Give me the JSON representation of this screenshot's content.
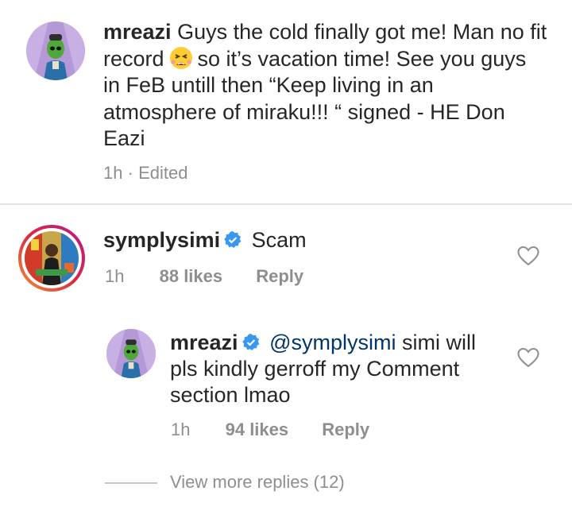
{
  "caption": {
    "username": "mreazi",
    "text_part1": "Guys the cold finally got me! Man no fit record",
    "emoji": "tired-face-emoji",
    "text_part2": "so it’s vacation time! See you guys in FeB untill then “Keep living in an atmosphere of miraku!!! “ signed - HE Don Eazi",
    "time": "1h",
    "separator": "·",
    "edited": "Edited"
  },
  "comment1": {
    "username": "symplysimi",
    "verified": true,
    "text": "Scam",
    "time": "1h",
    "likes": "88 likes",
    "reply": "Reply"
  },
  "reply1": {
    "username": "mreazi",
    "verified": true,
    "mention": "@symplysimi",
    "text": "simi will pls kindly gerroff my Comment section lmao",
    "time": "1h",
    "likes": "94 likes",
    "reply": "Reply"
  },
  "view_more": "View more replies (12)",
  "colors": {
    "verified": "#3897f0",
    "mention": "#003569",
    "meta": "#8e8e8e",
    "text": "#262626",
    "story_ring": [
      "#f09433",
      "#dc2743",
      "#bc1888"
    ]
  }
}
